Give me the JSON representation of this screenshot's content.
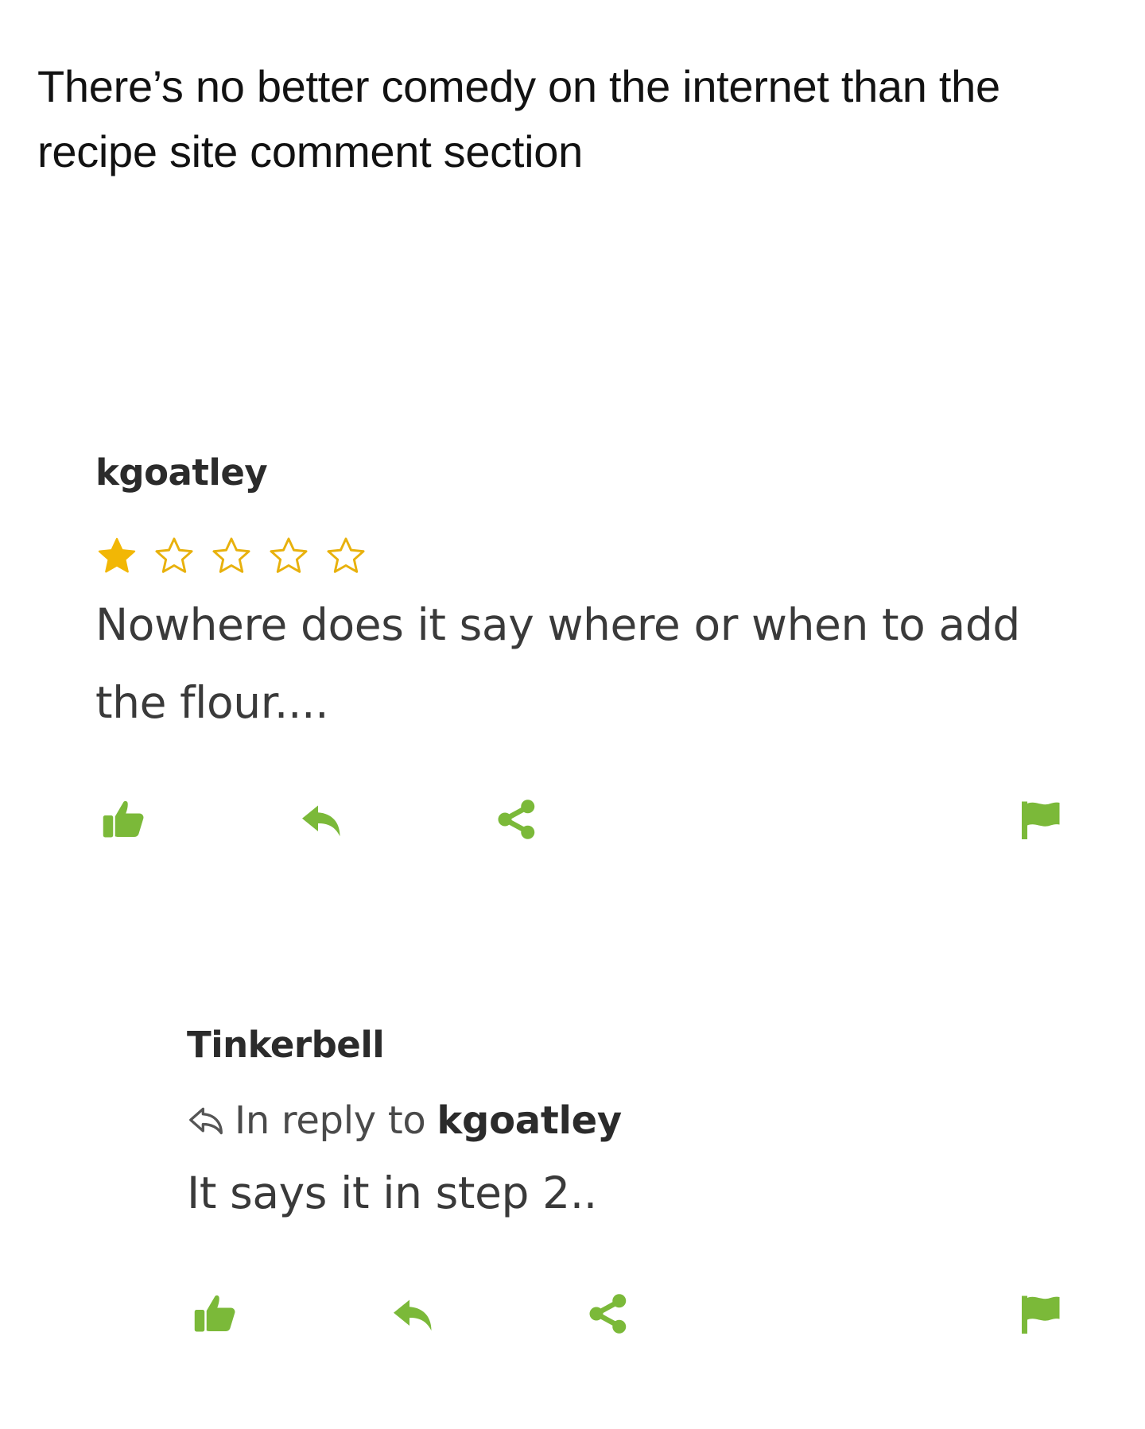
{
  "post": {
    "caption": "There’s no better comedy on the internet than the recipe site comment section"
  },
  "colors": {
    "accent_green": "#7bb939",
    "star_gold": "#f2b705"
  },
  "comments": [
    {
      "author": "kgoatley",
      "rating": 1,
      "rating_max": 5,
      "body": "Nowhere does it say where or when to add the flour....",
      "actions": [
        "thumbs-up-icon",
        "reply-arrow-icon",
        "share-icon",
        "flag-icon"
      ]
    },
    {
      "author": "Tinkerbell",
      "reply_prefix": "In reply to",
      "reply_to": "kgoatley",
      "body": "It says it in step 2..",
      "actions": [
        "thumbs-up-icon",
        "reply-arrow-icon",
        "share-icon",
        "flag-icon"
      ]
    }
  ]
}
